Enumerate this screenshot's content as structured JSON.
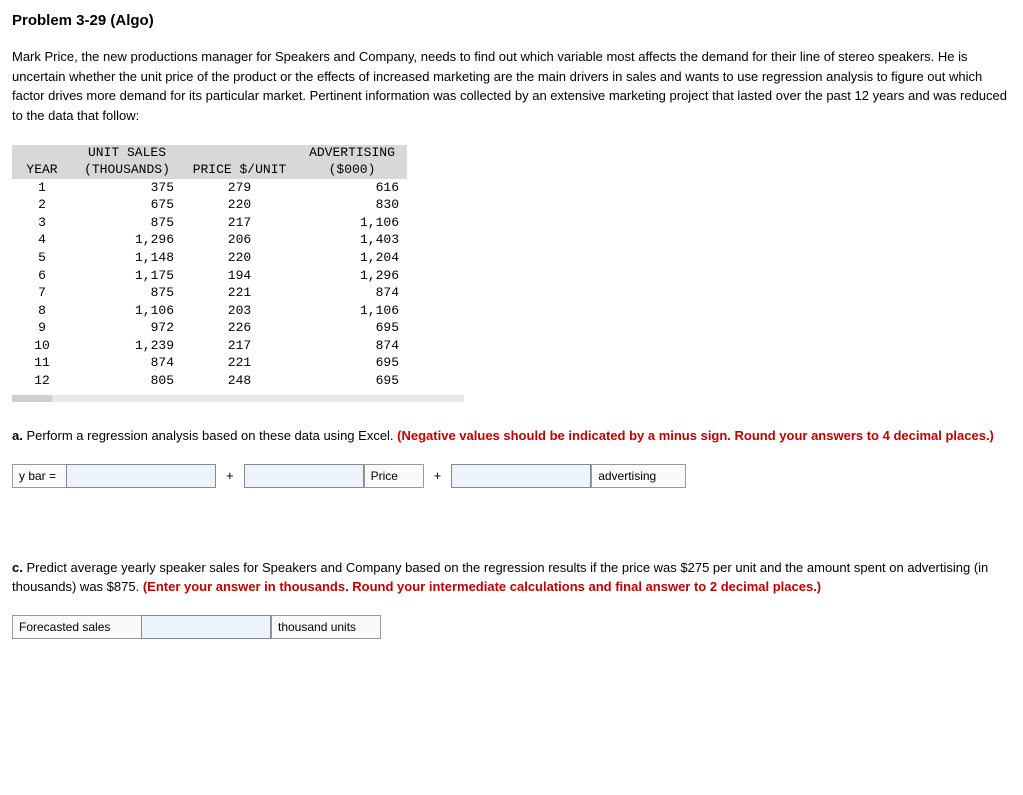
{
  "problem_title": "Problem 3-29 (Algo)",
  "intro_text": "Mark Price, the new productions manager for Speakers and Company, needs to find out which variable most affects the demand for their line of stereo speakers. He is uncertain whether the unit price of the product or the effects of increased marketing are the main drivers in sales and wants to use regression analysis to figure out which factor drives more demand for its particular market. Pertinent information was collected by an extensive marketing project that lasted over the past 12 years and was reduced to the data that follow:",
  "table": {
    "headers": {
      "year": "YEAR",
      "sales_l1": "UNIT SALES",
      "sales_l2": "(THOUSANDS)",
      "price": "PRICE $/UNIT",
      "adv_l1": "ADVERTISING",
      "adv_l2": "($000)"
    },
    "rows": [
      {
        "year": "1",
        "sales": "375",
        "price": "279",
        "adv": "616"
      },
      {
        "year": "2",
        "sales": "675",
        "price": "220",
        "adv": "830"
      },
      {
        "year": "3",
        "sales": "875",
        "price": "217",
        "adv": "1,106"
      },
      {
        "year": "4",
        "sales": "1,296",
        "price": "206",
        "adv": "1,403"
      },
      {
        "year": "5",
        "sales": "1,148",
        "price": "220",
        "adv": "1,204"
      },
      {
        "year": "6",
        "sales": "1,175",
        "price": "194",
        "adv": "1,296"
      },
      {
        "year": "7",
        "sales": "875",
        "price": "221",
        "adv": "874"
      },
      {
        "year": "8",
        "sales": "1,106",
        "price": "203",
        "adv": "1,106"
      },
      {
        "year": "9",
        "sales": "972",
        "price": "226",
        "adv": "695"
      },
      {
        "year": "10",
        "sales": "1,239",
        "price": "217",
        "adv": "874"
      },
      {
        "year": "11",
        "sales": "874",
        "price": "221",
        "adv": "695"
      },
      {
        "year": "12",
        "sales": "805",
        "price": "248",
        "adv": "695"
      }
    ]
  },
  "part_a": {
    "lead": "a.",
    "text": " Perform a regression analysis based on these data using Excel. ",
    "red": "(Negative values should be indicated by a minus sign. Round your answers to 4 decimal places.)"
  },
  "eq": {
    "ybar": "y bar =",
    "plus": "+",
    "price_label": "Price",
    "adv_label": "advertising"
  },
  "part_c": {
    "lead": "c.",
    "text": " Predict average yearly speaker sales for Speakers and Company based on the regression results if the price was $275 per unit and the amount spent on advertising (in thousands) was $875. ",
    "red": "(Enter your answer in thousands. Round your intermediate calculations and final answer to 2 decimal places.)"
  },
  "forecast": {
    "label": "Forecasted sales",
    "unit": "thousand units"
  }
}
